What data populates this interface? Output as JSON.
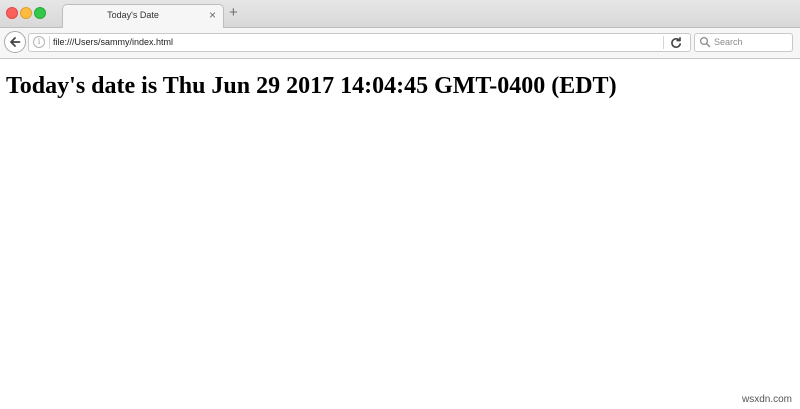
{
  "window": {
    "controls": [
      "close",
      "minimize",
      "maximize"
    ],
    "colors": {
      "close": "#fc605c",
      "minimize": "#fdbc40",
      "maximize": "#34c84a"
    }
  },
  "tab": {
    "title": "Today's Date",
    "close_glyph": "×",
    "new_tab_glyph": "+"
  },
  "navbar": {
    "back_icon": "back-arrow-icon",
    "info_icon": "info-icon",
    "info_glyph": "i",
    "url": "file:///Users/sammy/index.html",
    "reload_icon": "reload-icon",
    "search_icon": "search-icon",
    "search_placeholder": "Search"
  },
  "page": {
    "heading": "Today's date is Thu Jun 29 2017 14:04:45 GMT-0400 (EDT)"
  },
  "watermark": "wsxdn.com"
}
